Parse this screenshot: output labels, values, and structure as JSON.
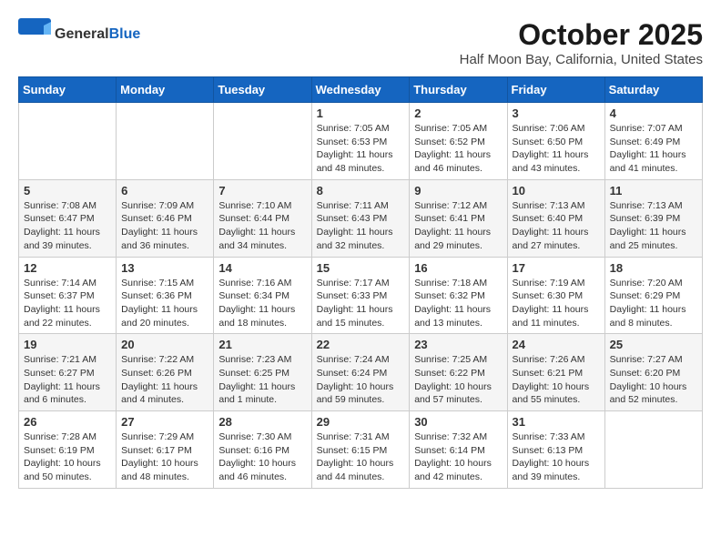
{
  "logo": {
    "general": "General",
    "blue": "Blue"
  },
  "title": "October 2025",
  "location": "Half Moon Bay, California, United States",
  "weekdays": [
    "Sunday",
    "Monday",
    "Tuesday",
    "Wednesday",
    "Thursday",
    "Friday",
    "Saturday"
  ],
  "weeks": [
    [
      {
        "day": "",
        "info": ""
      },
      {
        "day": "",
        "info": ""
      },
      {
        "day": "",
        "info": ""
      },
      {
        "day": "1",
        "info": "Sunrise: 7:05 AM\nSunset: 6:53 PM\nDaylight: 11 hours\nand 48 minutes."
      },
      {
        "day": "2",
        "info": "Sunrise: 7:05 AM\nSunset: 6:52 PM\nDaylight: 11 hours\nand 46 minutes."
      },
      {
        "day": "3",
        "info": "Sunrise: 7:06 AM\nSunset: 6:50 PM\nDaylight: 11 hours\nand 43 minutes."
      },
      {
        "day": "4",
        "info": "Sunrise: 7:07 AM\nSunset: 6:49 PM\nDaylight: 11 hours\nand 41 minutes."
      }
    ],
    [
      {
        "day": "5",
        "info": "Sunrise: 7:08 AM\nSunset: 6:47 PM\nDaylight: 11 hours\nand 39 minutes."
      },
      {
        "day": "6",
        "info": "Sunrise: 7:09 AM\nSunset: 6:46 PM\nDaylight: 11 hours\nand 36 minutes."
      },
      {
        "day": "7",
        "info": "Sunrise: 7:10 AM\nSunset: 6:44 PM\nDaylight: 11 hours\nand 34 minutes."
      },
      {
        "day": "8",
        "info": "Sunrise: 7:11 AM\nSunset: 6:43 PM\nDaylight: 11 hours\nand 32 minutes."
      },
      {
        "day": "9",
        "info": "Sunrise: 7:12 AM\nSunset: 6:41 PM\nDaylight: 11 hours\nand 29 minutes."
      },
      {
        "day": "10",
        "info": "Sunrise: 7:13 AM\nSunset: 6:40 PM\nDaylight: 11 hours\nand 27 minutes."
      },
      {
        "day": "11",
        "info": "Sunrise: 7:13 AM\nSunset: 6:39 PM\nDaylight: 11 hours\nand 25 minutes."
      }
    ],
    [
      {
        "day": "12",
        "info": "Sunrise: 7:14 AM\nSunset: 6:37 PM\nDaylight: 11 hours\nand 22 minutes."
      },
      {
        "day": "13",
        "info": "Sunrise: 7:15 AM\nSunset: 6:36 PM\nDaylight: 11 hours\nand 20 minutes."
      },
      {
        "day": "14",
        "info": "Sunrise: 7:16 AM\nSunset: 6:34 PM\nDaylight: 11 hours\nand 18 minutes."
      },
      {
        "day": "15",
        "info": "Sunrise: 7:17 AM\nSunset: 6:33 PM\nDaylight: 11 hours\nand 15 minutes."
      },
      {
        "day": "16",
        "info": "Sunrise: 7:18 AM\nSunset: 6:32 PM\nDaylight: 11 hours\nand 13 minutes."
      },
      {
        "day": "17",
        "info": "Sunrise: 7:19 AM\nSunset: 6:30 PM\nDaylight: 11 hours\nand 11 minutes."
      },
      {
        "day": "18",
        "info": "Sunrise: 7:20 AM\nSunset: 6:29 PM\nDaylight: 11 hours\nand 8 minutes."
      }
    ],
    [
      {
        "day": "19",
        "info": "Sunrise: 7:21 AM\nSunset: 6:27 PM\nDaylight: 11 hours\nand 6 minutes."
      },
      {
        "day": "20",
        "info": "Sunrise: 7:22 AM\nSunset: 6:26 PM\nDaylight: 11 hours\nand 4 minutes."
      },
      {
        "day": "21",
        "info": "Sunrise: 7:23 AM\nSunset: 6:25 PM\nDaylight: 11 hours\nand 1 minute."
      },
      {
        "day": "22",
        "info": "Sunrise: 7:24 AM\nSunset: 6:24 PM\nDaylight: 10 hours\nand 59 minutes."
      },
      {
        "day": "23",
        "info": "Sunrise: 7:25 AM\nSunset: 6:22 PM\nDaylight: 10 hours\nand 57 minutes."
      },
      {
        "day": "24",
        "info": "Sunrise: 7:26 AM\nSunset: 6:21 PM\nDaylight: 10 hours\nand 55 minutes."
      },
      {
        "day": "25",
        "info": "Sunrise: 7:27 AM\nSunset: 6:20 PM\nDaylight: 10 hours\nand 52 minutes."
      }
    ],
    [
      {
        "day": "26",
        "info": "Sunrise: 7:28 AM\nSunset: 6:19 PM\nDaylight: 10 hours\nand 50 minutes."
      },
      {
        "day": "27",
        "info": "Sunrise: 7:29 AM\nSunset: 6:17 PM\nDaylight: 10 hours\nand 48 minutes."
      },
      {
        "day": "28",
        "info": "Sunrise: 7:30 AM\nSunset: 6:16 PM\nDaylight: 10 hours\nand 46 minutes."
      },
      {
        "day": "29",
        "info": "Sunrise: 7:31 AM\nSunset: 6:15 PM\nDaylight: 10 hours\nand 44 minutes."
      },
      {
        "day": "30",
        "info": "Sunrise: 7:32 AM\nSunset: 6:14 PM\nDaylight: 10 hours\nand 42 minutes."
      },
      {
        "day": "31",
        "info": "Sunrise: 7:33 AM\nSunset: 6:13 PM\nDaylight: 10 hours\nand 39 minutes."
      },
      {
        "day": "",
        "info": ""
      }
    ]
  ]
}
